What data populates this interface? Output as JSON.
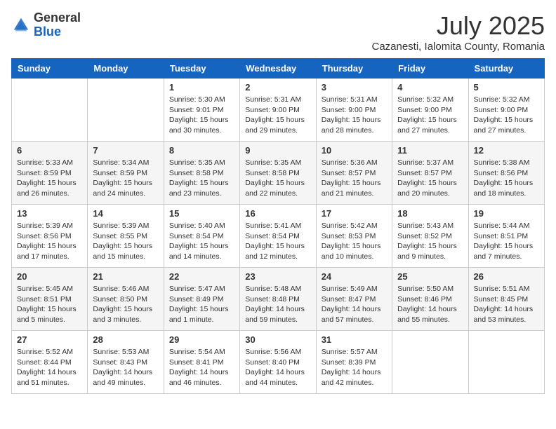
{
  "logo": {
    "general": "General",
    "blue": "Blue"
  },
  "title": "July 2025",
  "location": "Cazanesti, Ialomita County, Romania",
  "days_of_week": [
    "Sunday",
    "Monday",
    "Tuesday",
    "Wednesday",
    "Thursday",
    "Friday",
    "Saturday"
  ],
  "weeks": [
    [
      {
        "day": "",
        "info": ""
      },
      {
        "day": "",
        "info": ""
      },
      {
        "day": "1",
        "info": "Sunrise: 5:30 AM\nSunset: 9:01 PM\nDaylight: 15 hours\nand 30 minutes."
      },
      {
        "day": "2",
        "info": "Sunrise: 5:31 AM\nSunset: 9:00 PM\nDaylight: 15 hours\nand 29 minutes."
      },
      {
        "day": "3",
        "info": "Sunrise: 5:31 AM\nSunset: 9:00 PM\nDaylight: 15 hours\nand 28 minutes."
      },
      {
        "day": "4",
        "info": "Sunrise: 5:32 AM\nSunset: 9:00 PM\nDaylight: 15 hours\nand 27 minutes."
      },
      {
        "day": "5",
        "info": "Sunrise: 5:32 AM\nSunset: 9:00 PM\nDaylight: 15 hours\nand 27 minutes."
      }
    ],
    [
      {
        "day": "6",
        "info": "Sunrise: 5:33 AM\nSunset: 8:59 PM\nDaylight: 15 hours\nand 26 minutes."
      },
      {
        "day": "7",
        "info": "Sunrise: 5:34 AM\nSunset: 8:59 PM\nDaylight: 15 hours\nand 24 minutes."
      },
      {
        "day": "8",
        "info": "Sunrise: 5:35 AM\nSunset: 8:58 PM\nDaylight: 15 hours\nand 23 minutes."
      },
      {
        "day": "9",
        "info": "Sunrise: 5:35 AM\nSunset: 8:58 PM\nDaylight: 15 hours\nand 22 minutes."
      },
      {
        "day": "10",
        "info": "Sunrise: 5:36 AM\nSunset: 8:57 PM\nDaylight: 15 hours\nand 21 minutes."
      },
      {
        "day": "11",
        "info": "Sunrise: 5:37 AM\nSunset: 8:57 PM\nDaylight: 15 hours\nand 20 minutes."
      },
      {
        "day": "12",
        "info": "Sunrise: 5:38 AM\nSunset: 8:56 PM\nDaylight: 15 hours\nand 18 minutes."
      }
    ],
    [
      {
        "day": "13",
        "info": "Sunrise: 5:39 AM\nSunset: 8:56 PM\nDaylight: 15 hours\nand 17 minutes."
      },
      {
        "day": "14",
        "info": "Sunrise: 5:39 AM\nSunset: 8:55 PM\nDaylight: 15 hours\nand 15 minutes."
      },
      {
        "day": "15",
        "info": "Sunrise: 5:40 AM\nSunset: 8:54 PM\nDaylight: 15 hours\nand 14 minutes."
      },
      {
        "day": "16",
        "info": "Sunrise: 5:41 AM\nSunset: 8:54 PM\nDaylight: 15 hours\nand 12 minutes."
      },
      {
        "day": "17",
        "info": "Sunrise: 5:42 AM\nSunset: 8:53 PM\nDaylight: 15 hours\nand 10 minutes."
      },
      {
        "day": "18",
        "info": "Sunrise: 5:43 AM\nSunset: 8:52 PM\nDaylight: 15 hours\nand 9 minutes."
      },
      {
        "day": "19",
        "info": "Sunrise: 5:44 AM\nSunset: 8:51 PM\nDaylight: 15 hours\nand 7 minutes."
      }
    ],
    [
      {
        "day": "20",
        "info": "Sunrise: 5:45 AM\nSunset: 8:51 PM\nDaylight: 15 hours\nand 5 minutes."
      },
      {
        "day": "21",
        "info": "Sunrise: 5:46 AM\nSunset: 8:50 PM\nDaylight: 15 hours\nand 3 minutes."
      },
      {
        "day": "22",
        "info": "Sunrise: 5:47 AM\nSunset: 8:49 PM\nDaylight: 15 hours\nand 1 minute."
      },
      {
        "day": "23",
        "info": "Sunrise: 5:48 AM\nSunset: 8:48 PM\nDaylight: 14 hours\nand 59 minutes."
      },
      {
        "day": "24",
        "info": "Sunrise: 5:49 AM\nSunset: 8:47 PM\nDaylight: 14 hours\nand 57 minutes."
      },
      {
        "day": "25",
        "info": "Sunrise: 5:50 AM\nSunset: 8:46 PM\nDaylight: 14 hours\nand 55 minutes."
      },
      {
        "day": "26",
        "info": "Sunrise: 5:51 AM\nSunset: 8:45 PM\nDaylight: 14 hours\nand 53 minutes."
      }
    ],
    [
      {
        "day": "27",
        "info": "Sunrise: 5:52 AM\nSunset: 8:44 PM\nDaylight: 14 hours\nand 51 minutes."
      },
      {
        "day": "28",
        "info": "Sunrise: 5:53 AM\nSunset: 8:43 PM\nDaylight: 14 hours\nand 49 minutes."
      },
      {
        "day": "29",
        "info": "Sunrise: 5:54 AM\nSunset: 8:41 PM\nDaylight: 14 hours\nand 46 minutes."
      },
      {
        "day": "30",
        "info": "Sunrise: 5:56 AM\nSunset: 8:40 PM\nDaylight: 14 hours\nand 44 minutes."
      },
      {
        "day": "31",
        "info": "Sunrise: 5:57 AM\nSunset: 8:39 PM\nDaylight: 14 hours\nand 42 minutes."
      },
      {
        "day": "",
        "info": ""
      },
      {
        "day": "",
        "info": ""
      }
    ]
  ]
}
